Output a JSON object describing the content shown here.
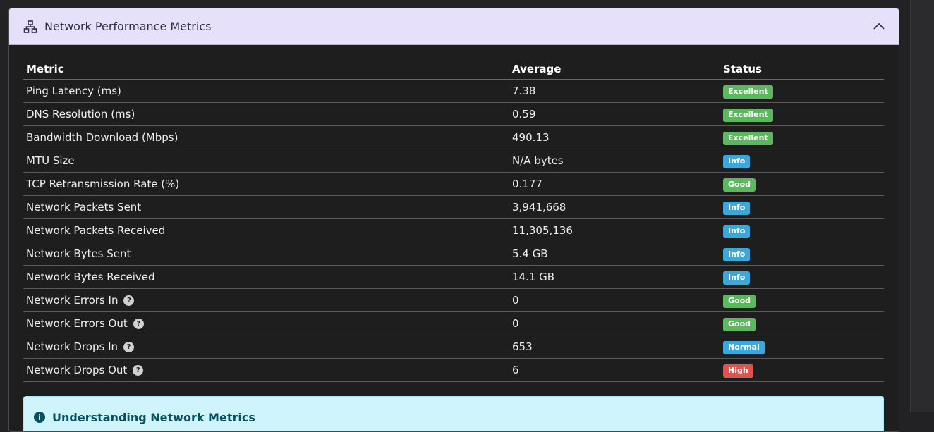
{
  "panel": {
    "title": "Network Performance Metrics",
    "header_color": "#e6e0fa"
  },
  "table": {
    "headers": {
      "metric": "Metric",
      "average": "Average",
      "status": "Status"
    },
    "rows": [
      {
        "metric": "Ping Latency (ms)",
        "average": "7.38",
        "status": "Excellent",
        "status_color": "#5cb85c",
        "help": false
      },
      {
        "metric": "DNS Resolution (ms)",
        "average": "0.59",
        "status": "Excellent",
        "status_color": "#5cb85c",
        "help": false
      },
      {
        "metric": "Bandwidth Download (Mbps)",
        "average": "490.13",
        "status": "Excellent",
        "status_color": "#5cb85c",
        "help": false
      },
      {
        "metric": "MTU Size",
        "average": "N/A bytes",
        "status": "Info",
        "status_color": "#3aa8d8",
        "help": false
      },
      {
        "metric": "TCP Retransmission Rate (%)",
        "average": "0.177",
        "status": "Good",
        "status_color": "#5cb85c",
        "help": false
      },
      {
        "metric": "Network Packets Sent",
        "average": "3,941,668",
        "status": "Info",
        "status_color": "#3aa8d8",
        "help": false
      },
      {
        "metric": "Network Packets Received",
        "average": "11,305,136",
        "status": "Info",
        "status_color": "#3aa8d8",
        "help": false
      },
      {
        "metric": "Network Bytes Sent",
        "average": "5.4 GB",
        "status": "Info",
        "status_color": "#3aa8d8",
        "help": false
      },
      {
        "metric": "Network Bytes Received",
        "average": "14.1 GB",
        "status": "Info",
        "status_color": "#3aa8d8",
        "help": false
      },
      {
        "metric": "Network Errors In",
        "average": "0",
        "status": "Good",
        "status_color": "#5cb85c",
        "help": true
      },
      {
        "metric": "Network Errors Out",
        "average": "0",
        "status": "Good",
        "status_color": "#5cb85c",
        "help": true
      },
      {
        "metric": "Network Drops In",
        "average": "653",
        "status": "Normal",
        "status_color": "#3aa8d8",
        "help": true
      },
      {
        "metric": "Network Drops Out",
        "average": "6",
        "status": "High",
        "status_color": "#e0524d",
        "help": true
      }
    ]
  },
  "info_panel": {
    "text": "Understanding Network Metrics"
  },
  "icons": {
    "header_icon": "network-icon",
    "collapse_icon": "chevron-up-icon",
    "help_icon": "question-circle-icon",
    "info_icon": "info-circle-icon"
  }
}
